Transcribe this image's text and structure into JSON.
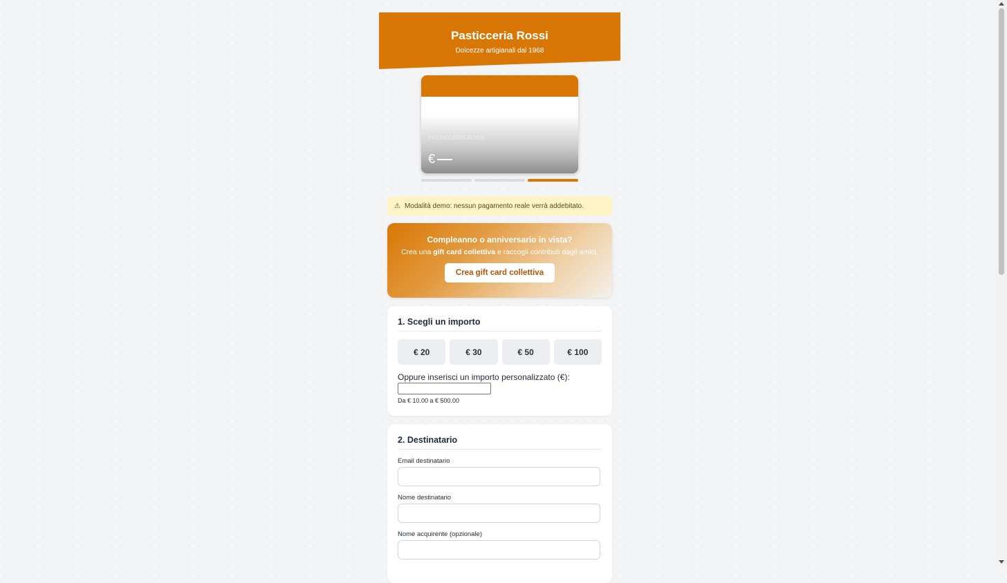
{
  "header": {
    "title": "Pasticceria Rossi",
    "subtitle": "Dolcezze artigianali dal 1968"
  },
  "card_preview": {
    "brand": "PASTICCERIA ROSSI",
    "amount": "€"
  },
  "progress": {
    "steps": 3,
    "active_step": 3
  },
  "demo_notice": {
    "icon": "warning-icon",
    "text": "Modalità demo: nessun pagamento reale verrà addebitato."
  },
  "promo": {
    "title": "Compleanno o anniversario in vista?",
    "text_before": "Crea una ",
    "text_bold": "gift card collettiva",
    "text_after": " e raccogli contributi dagli amici.",
    "button": "Crea gift card collettiva"
  },
  "amount_section": {
    "title": "1. Scegli un importo",
    "options": [
      "€ 20",
      "€ 30",
      "€ 50",
      "€ 100"
    ],
    "custom_label": "Oppure inserisci un importo personalizzato (€):",
    "custom_value": "",
    "hint": "Da € 10.00 a € 500.00"
  },
  "recipient_section": {
    "title": "2. Destinatario",
    "email_label": "Email destinatario",
    "name_label": "Nome destinatario",
    "buyer_label": "Nome acquirente (opzionale)"
  },
  "colors": {
    "accent": "#d97706",
    "background": "#f3f4f6",
    "notice": "#fdf3c7"
  }
}
